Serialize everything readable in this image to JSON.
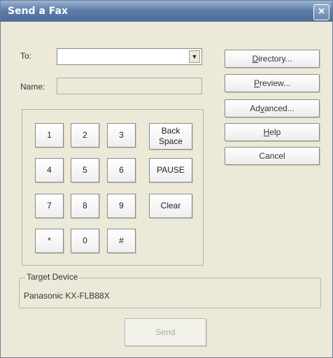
{
  "window": {
    "title": "Send a Fax",
    "close_glyph": "×"
  },
  "to": {
    "label": "To:",
    "value": "",
    "dropdown_glyph": "▼"
  },
  "name": {
    "label": "Name:",
    "value": ""
  },
  "buttons": {
    "directory": {
      "accel": "D",
      "rest": "irectory..."
    },
    "preview": {
      "accel": "P",
      "rest": "review..."
    },
    "advanced": {
      "pre": "Ad",
      "accel": "v",
      "rest": "anced..."
    },
    "help": {
      "accel": "H",
      "rest": "elp"
    },
    "cancel": "Cancel"
  },
  "keypad": {
    "keys": [
      "1",
      "2",
      "3",
      "4",
      "5",
      "6",
      "7",
      "8",
      "9",
      "*",
      "0",
      "#"
    ],
    "backspace_line1": "Back",
    "backspace_line2": "Space",
    "pause": "PAUSE",
    "clear": "Clear"
  },
  "target": {
    "title": "Target Device",
    "device": "Panasonic KX-FLB88X"
  },
  "send": "Send"
}
